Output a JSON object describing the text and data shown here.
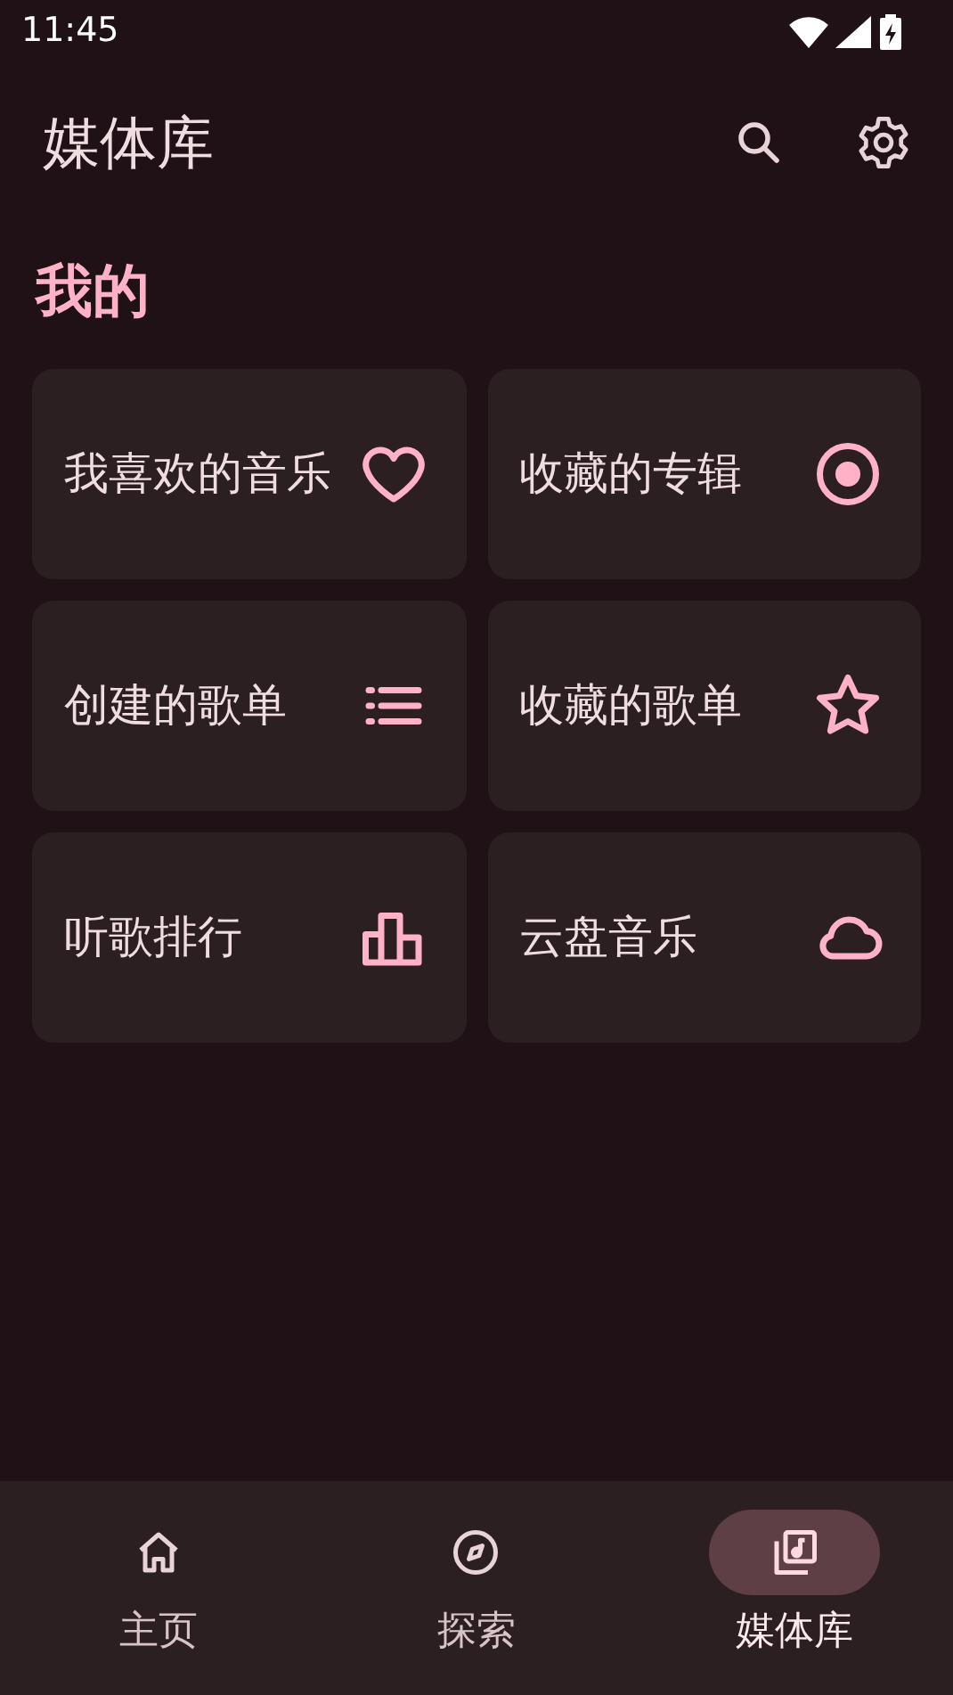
{
  "status_bar": {
    "time": "11:45"
  },
  "header": {
    "title": "媒体库"
  },
  "section": {
    "title": "我的"
  },
  "cards": [
    {
      "label": "我喜欢的音乐",
      "kind": "heart"
    },
    {
      "label": "收藏的专辑",
      "kind": "disc"
    },
    {
      "label": "创建的歌单",
      "kind": "list"
    },
    {
      "label": "收藏的歌单",
      "kind": "star"
    },
    {
      "label": "听歌排行",
      "kind": "chart"
    },
    {
      "label": "云盘音乐",
      "kind": "cloud"
    }
  ],
  "nav": [
    {
      "label": "主页",
      "kind": "home",
      "selected": false
    },
    {
      "label": "探索",
      "kind": "explore",
      "selected": false
    },
    {
      "label": "媒体库",
      "kind": "library",
      "selected": true
    }
  ]
}
